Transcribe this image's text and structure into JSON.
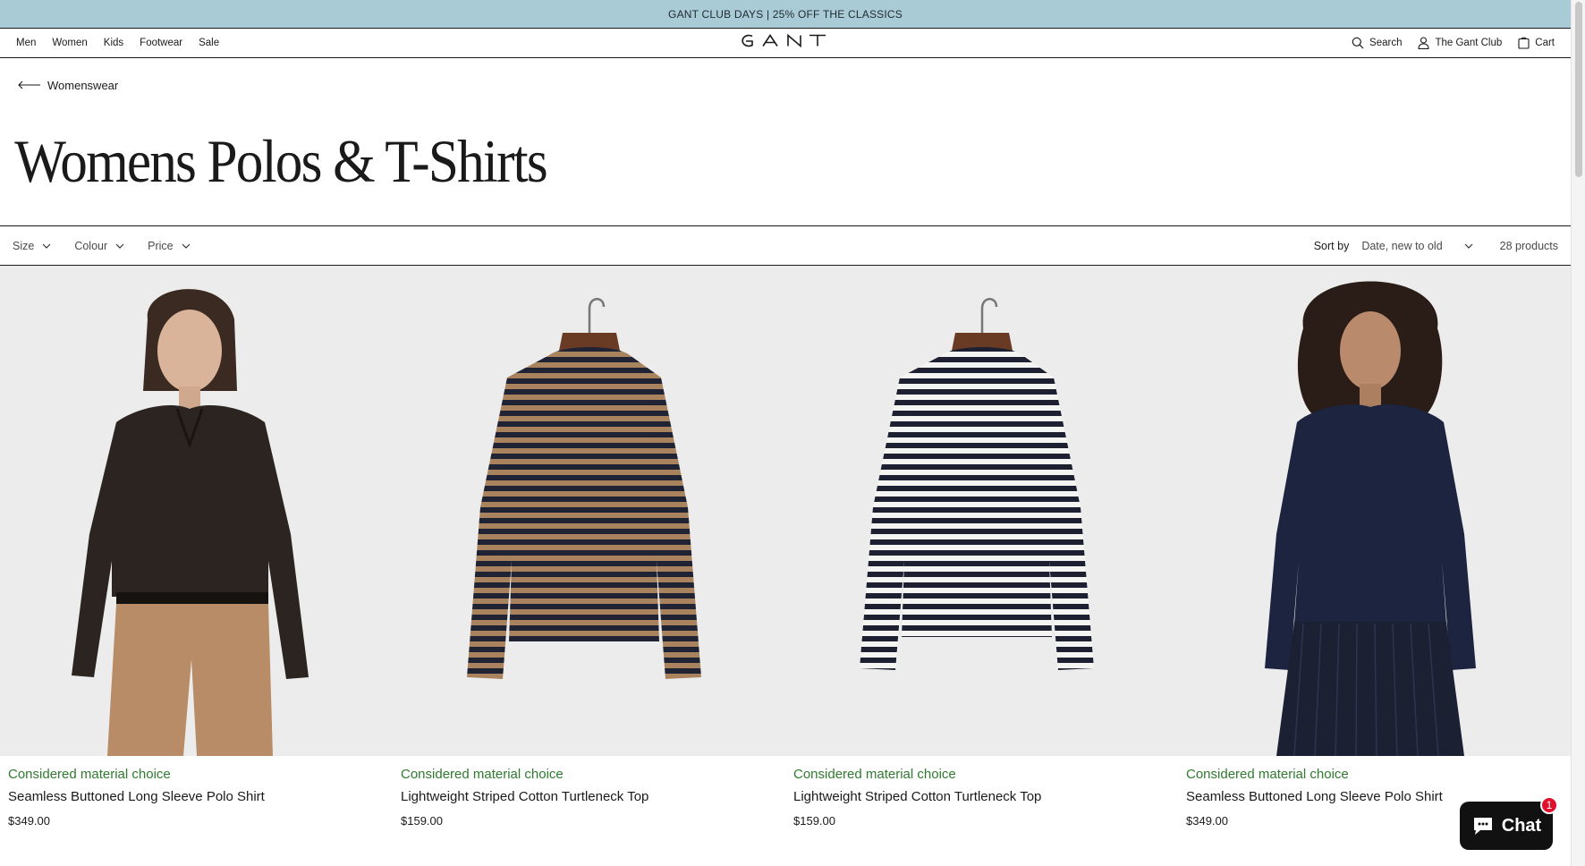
{
  "announcement": "GANT CLUB DAYS | 25% OFF THE CLASSICS",
  "header": {
    "nav": [
      "Men",
      "Women",
      "Kids",
      "Footwear",
      "Sale"
    ],
    "logo_text": "GANT",
    "search_label": "Search",
    "club_label": "The Gant Club",
    "cart_label": "Cart"
  },
  "breadcrumb": {
    "label": "Womenswear"
  },
  "page_title": "Womens Polos & T-Shirts",
  "filters": {
    "size": "Size",
    "colour": "Colour",
    "price": "Price",
    "sort_label": "Sort by",
    "sort_value": "Date, new to old",
    "count": "28 products"
  },
  "products": [
    {
      "badge": "Considered material choice",
      "name": "Seamless Buttoned Long Sleeve Polo Shirt",
      "price": "$349.00"
    },
    {
      "badge": "Considered material choice",
      "name": "Lightweight Striped Cotton Turtleneck Top",
      "price": "$159.00"
    },
    {
      "badge": "Considered material choice",
      "name": "Lightweight Striped Cotton Turtleneck Top",
      "price": "$159.00"
    },
    {
      "badge": "Considered material choice",
      "name": "Seamless Buttoned Long Sleeve Polo Shirt",
      "price": "$349.00"
    }
  ],
  "chat": {
    "label": "Chat",
    "badge_count": "1"
  },
  "colors": {
    "announcement_bg": "#a9cbd6",
    "badge_green": "#2f7a2f",
    "chat_bg": "#111111",
    "notif_red": "#e0102c"
  }
}
